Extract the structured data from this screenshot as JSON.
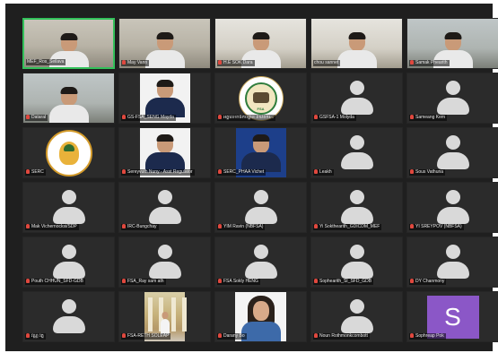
{
  "colors": {
    "background": "#1f1f1f",
    "tile": "#2b2b2b",
    "active_speaker_border": "#33c15a",
    "muted_mic": "#e0483e",
    "avatar": "#d9d9d9",
    "letter_avatar": "#8b57c7"
  },
  "participants": [
    {
      "name": "MEF_Ros_Seilava",
      "muted": false,
      "video": "room",
      "active": true
    },
    {
      "name": "May Vann",
      "muted": true,
      "video": "room"
    },
    {
      "name": "H.E SOK Dara",
      "muted": true,
      "video": "room2"
    },
    {
      "name": "chou sannet",
      "muted": false,
      "video": "room2"
    },
    {
      "name": "Samak Phearith",
      "muted": true,
      "video": "room3"
    },
    {
      "name": "Dataral",
      "muted": true,
      "video": "room3"
    },
    {
      "name": "GS-FSA_SENG Mayda",
      "muted": true,
      "video": "portrait"
    },
    {
      "name": "អគ្គលេខាធិការដ្ឋាន និយ័តករ...",
      "muted": true,
      "video": "logo"
    },
    {
      "name": "GSFSA-1 Molyda",
      "muted": true,
      "video": "none"
    },
    {
      "name": "Sameang Kem",
      "muted": true,
      "video": "none"
    },
    {
      "name": "SERC",
      "muted": true,
      "video": "seal"
    },
    {
      "name": "Sereyvuth Nuny - Asst Regulator",
      "muted": true,
      "video": "portrait"
    },
    {
      "name": "SERC_PHAA Vichet",
      "muted": true,
      "video": "portrait2"
    },
    {
      "name": "Leakh",
      "muted": true,
      "video": "none"
    },
    {
      "name": "Sous Vathuna",
      "muted": true,
      "video": "none"
    },
    {
      "name": "Mak Vichernocksi/SDP",
      "muted": true,
      "video": "none"
    },
    {
      "name": "IRC-Bungchay",
      "muted": true,
      "video": "none"
    },
    {
      "name": "YIM Ravin (NBFSA)",
      "muted": true,
      "video": "none"
    },
    {
      "name": "Yi Sokthearith_GDICDM_MEF",
      "muted": true,
      "video": "none"
    },
    {
      "name": "YI SREYPOV (NBFSA)",
      "muted": true,
      "video": "none"
    },
    {
      "name": "Pouth CHHUN_SFD-GDB",
      "muted": true,
      "video": "none"
    },
    {
      "name": "FSA_Ray sam ath",
      "muted": true,
      "video": "none"
    },
    {
      "name": "FSA Sokly HENG",
      "muted": true,
      "video": "none"
    },
    {
      "name": "Sophearith_SI_SFD_GDB",
      "muted": true,
      "video": "none"
    },
    {
      "name": "DY Chanmony",
      "muted": true,
      "video": "none"
    },
    {
      "name": "វណ្ណ រ័ត្ន",
      "muted": true,
      "video": "none"
    },
    {
      "name": "FSA-RETH SOLEAP",
      "muted": true,
      "video": "building"
    },
    {
      "name": "Darany Bo",
      "muted": true,
      "video": "woman"
    },
    {
      "name": "Noun Rothmonkcombott",
      "muted": true,
      "video": "none"
    },
    {
      "name": "Sophreap Pok",
      "muted": true,
      "video": "letter",
      "letter": "S"
    }
  ]
}
